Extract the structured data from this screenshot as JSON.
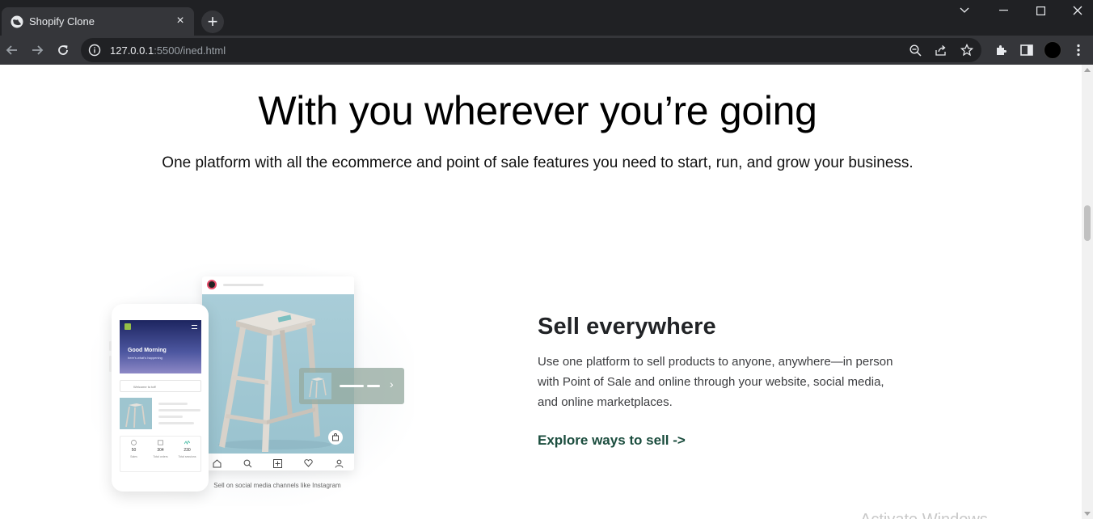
{
  "browser": {
    "tab": {
      "title": "Shopify Clone",
      "close_icon": "×"
    },
    "new_tab_icon": "+",
    "url": {
      "host": "127.0.0.1",
      "path": ":5500/ined.html"
    }
  },
  "hero": {
    "title": "With you wherever you’re going",
    "subtitle": "One platform with all the ecommerce and point of sale features you need to start, run, and grow your business."
  },
  "illustration": {
    "phone": {
      "greeting": "Good Morning",
      "greeting_sub": "here's what's happening",
      "search_placeholder": "Welcome to toff",
      "stats": [
        {
          "value": "50",
          "label": "Sales"
        },
        {
          "value": "304",
          "label": "Total orders"
        },
        {
          "value": "230",
          "label": "Total sessions"
        }
      ]
    },
    "caption": "Sell on social media channels like Instagram"
  },
  "feature": {
    "title": "Sell everywhere",
    "description": "Use one platform to sell products to anyone, anywhere—in person with Point of Sale and online through your website, social media, and online marketplaces.",
    "link": "Explore ways to sell ->"
  },
  "watermark": "Activate Windows",
  "colors": {
    "accent_link": "#1b4d3e",
    "shopify_green": "#95bf47",
    "chrome_dark": "#202124"
  }
}
